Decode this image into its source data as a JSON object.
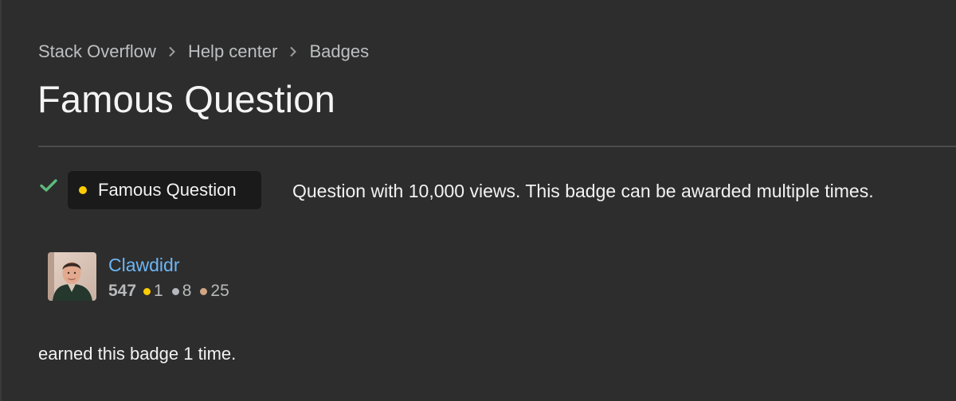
{
  "breadcrumb": {
    "items": [
      {
        "label": "Stack Overflow"
      },
      {
        "label": "Help center"
      },
      {
        "label": "Badges"
      }
    ]
  },
  "page": {
    "title": "Famous Question"
  },
  "badge": {
    "name": "Famous Question",
    "tier": "gold",
    "description": "Question with 10,000 views. This badge can be awarded multiple times.",
    "awarded_icon": "checkmark-icon"
  },
  "user": {
    "name": "Clawdidr",
    "reputation": "547",
    "gold": "1",
    "silver": "8",
    "bronze": "25",
    "avatar_icon": "user-avatar"
  },
  "earned": {
    "text": "earned this badge 1 time."
  },
  "colors": {
    "background": "#2d2d2d",
    "link": "#6cb6f5",
    "gold": "#ffcc01",
    "silver": "#b4b8bc",
    "bronze": "#d1a684",
    "check": "#5eba7d"
  }
}
